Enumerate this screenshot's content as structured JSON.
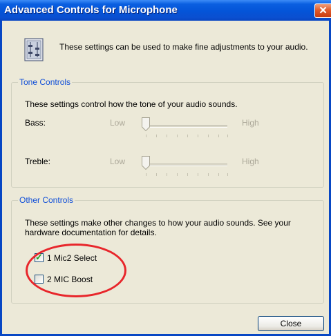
{
  "window": {
    "title": "Advanced Controls for Microphone",
    "close_glyph": "✕",
    "icon": "audio-settings-icon",
    "intro": "These settings can be used to make fine adjustments to your audio."
  },
  "tone_controls": {
    "legend": "Tone Controls",
    "description": "These settings control how the tone of your audio sounds.",
    "bass": {
      "label": "Bass:",
      "low": "Low",
      "high": "High",
      "level": 0
    },
    "treble": {
      "label": "Treble:",
      "low": "Low",
      "high": "High",
      "level": 0
    }
  },
  "other_controls": {
    "legend": "Other Controls",
    "description": "These settings make other changes to how your audio sounds.  See your hardware documentation for details.",
    "options": [
      {
        "label": "1  Mic2 Select",
        "checked": true
      },
      {
        "label": "2  MIC Boost",
        "checked": false
      }
    ]
  },
  "buttons": {
    "close": "Close"
  },
  "colors": {
    "titlebar": "#0454d8",
    "legend_text": "#1250d8",
    "annotation": "#e8262b",
    "disabled_text": "#aca899"
  }
}
